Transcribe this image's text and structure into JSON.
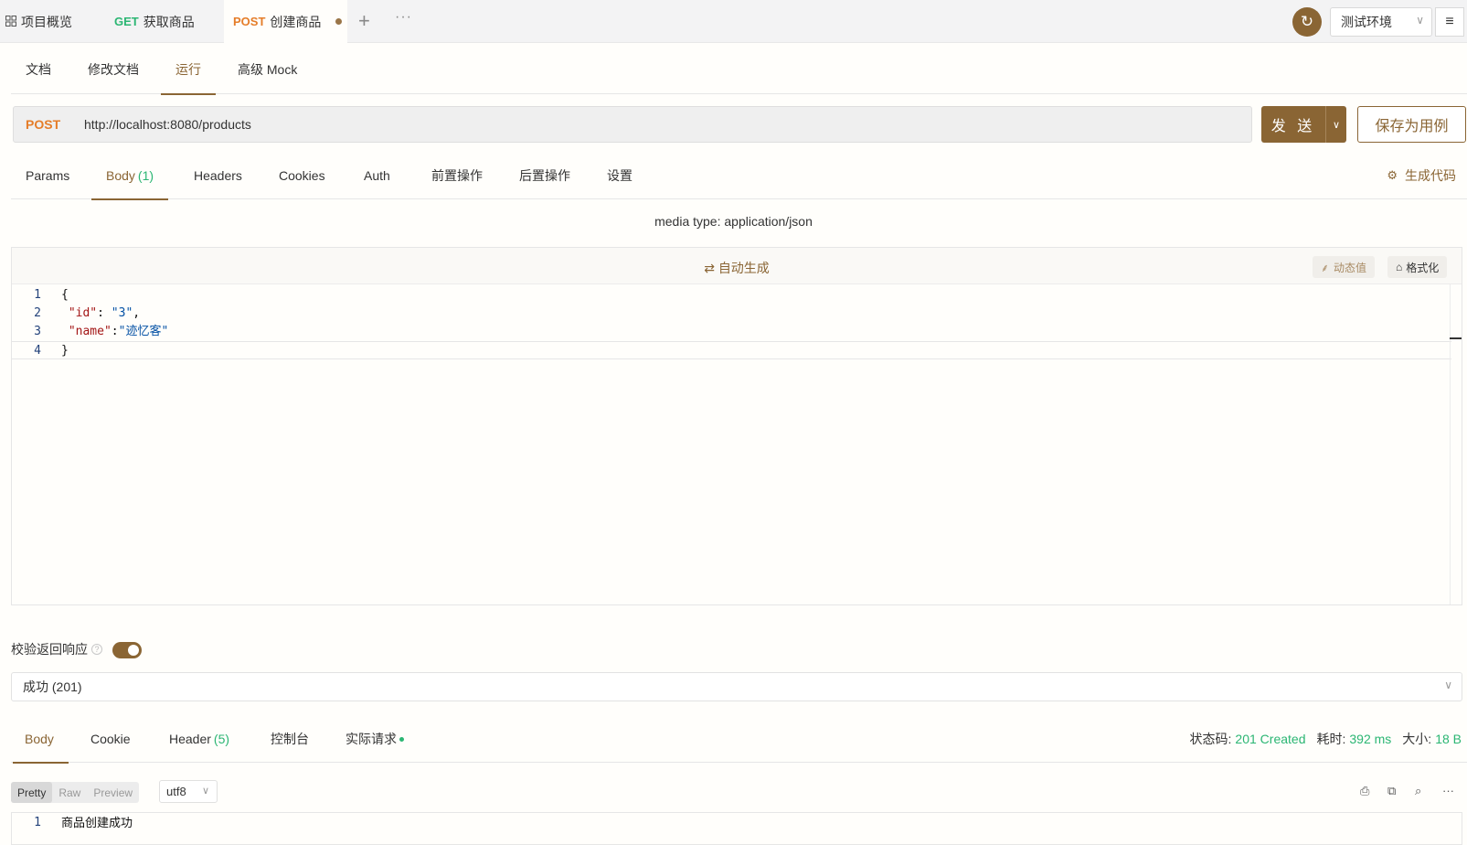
{
  "top_tabs": [
    {
      "icon": "grid-icon",
      "label": "项目概览"
    },
    {
      "method": "GET",
      "label": "获取商品"
    },
    {
      "method": "POST",
      "label": "创建商品",
      "unsaved": true
    }
  ],
  "top_actions": {
    "add": "+",
    "more": "···",
    "env": "测试环境"
  },
  "doc_tabs": [
    "文档",
    "修改文档",
    "运行",
    "高级 Mock"
  ],
  "request": {
    "method": "POST",
    "url": "http://localhost:8080/products",
    "send_label": "发 送",
    "save_label": "保存为用例"
  },
  "req_tabs": {
    "params": "Params",
    "body": "Body",
    "body_count": "(1)",
    "headers": "Headers",
    "cookies": "Cookies",
    "auth": "Auth",
    "pre": "前置操作",
    "post": "后置操作",
    "settings": "设置",
    "gen_code": "生成代码"
  },
  "media_type": "media type: application/json",
  "editor": {
    "auto_generate": "自动生成",
    "dynamic_value": "动态值",
    "format": "格式化",
    "lines": [
      "1",
      "2",
      "3",
      "4"
    ],
    "line1": "{",
    "id_key": "\"id\"",
    "id_sep": ": ",
    "id_val": "\"3\"",
    "id_end": ",",
    "name_key": "\"name\"",
    "name_sep": ":",
    "name_val": "\"迹忆客\"",
    "line4": "}"
  },
  "validate": {
    "label": "校验返回响应",
    "enabled": true,
    "selected": "成功 (201)"
  },
  "resp_tabs": {
    "body": "Body",
    "cookie": "Cookie",
    "header": "Header",
    "header_count": "(5)",
    "console": "控制台",
    "actual": "实际请求"
  },
  "stats": {
    "status_label": "状态码:",
    "status_value": "201 Created",
    "time_label": "耗时:",
    "time_value": "392 ms",
    "size_label": "大小:",
    "size_value": "18 B"
  },
  "view_modes": [
    "Pretty",
    "Raw",
    "Preview"
  ],
  "encoding": "utf8",
  "response": {
    "line_no": "1",
    "text": "商品创建成功"
  },
  "colors": {
    "accent": "#8a6534",
    "get": "#2bb673",
    "post": "#e57d29",
    "success": "#2bb673"
  }
}
